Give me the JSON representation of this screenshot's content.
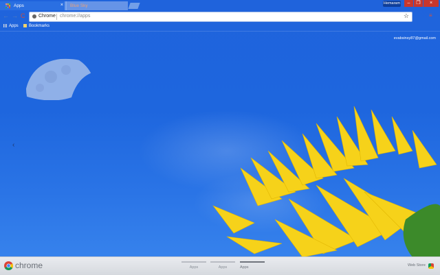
{
  "tabs": [
    {
      "label": "Apps",
      "close": "×"
    },
    {
      "label": "Blue Sky"
    }
  ],
  "window": {
    "profile": "Hemaram",
    "min": "–",
    "max": "❐",
    "close": "×"
  },
  "toolbar": {
    "back": "←",
    "forward": "→",
    "reload": "C",
    "chip_label": "Chrome",
    "url": "chrome://apps",
    "star": "☆",
    "menu": "≡"
  },
  "bookmarks": [
    {
      "label": "Apps"
    },
    {
      "label": "Bookmarks"
    }
  ],
  "account_email": "evabsinsy87@gmail.com",
  "prev_arrow": "‹",
  "bottom": {
    "brand": "chrome",
    "pages": [
      {
        "label": "Apps",
        "active": false
      },
      {
        "label": "Apps",
        "active": false
      },
      {
        "label": "Apps",
        "active": true
      }
    ],
    "webstore": "Web Store"
  },
  "colors": {
    "sky": "#1f63dc",
    "petal": "#f6d21a",
    "window_red": "#c8372d"
  }
}
